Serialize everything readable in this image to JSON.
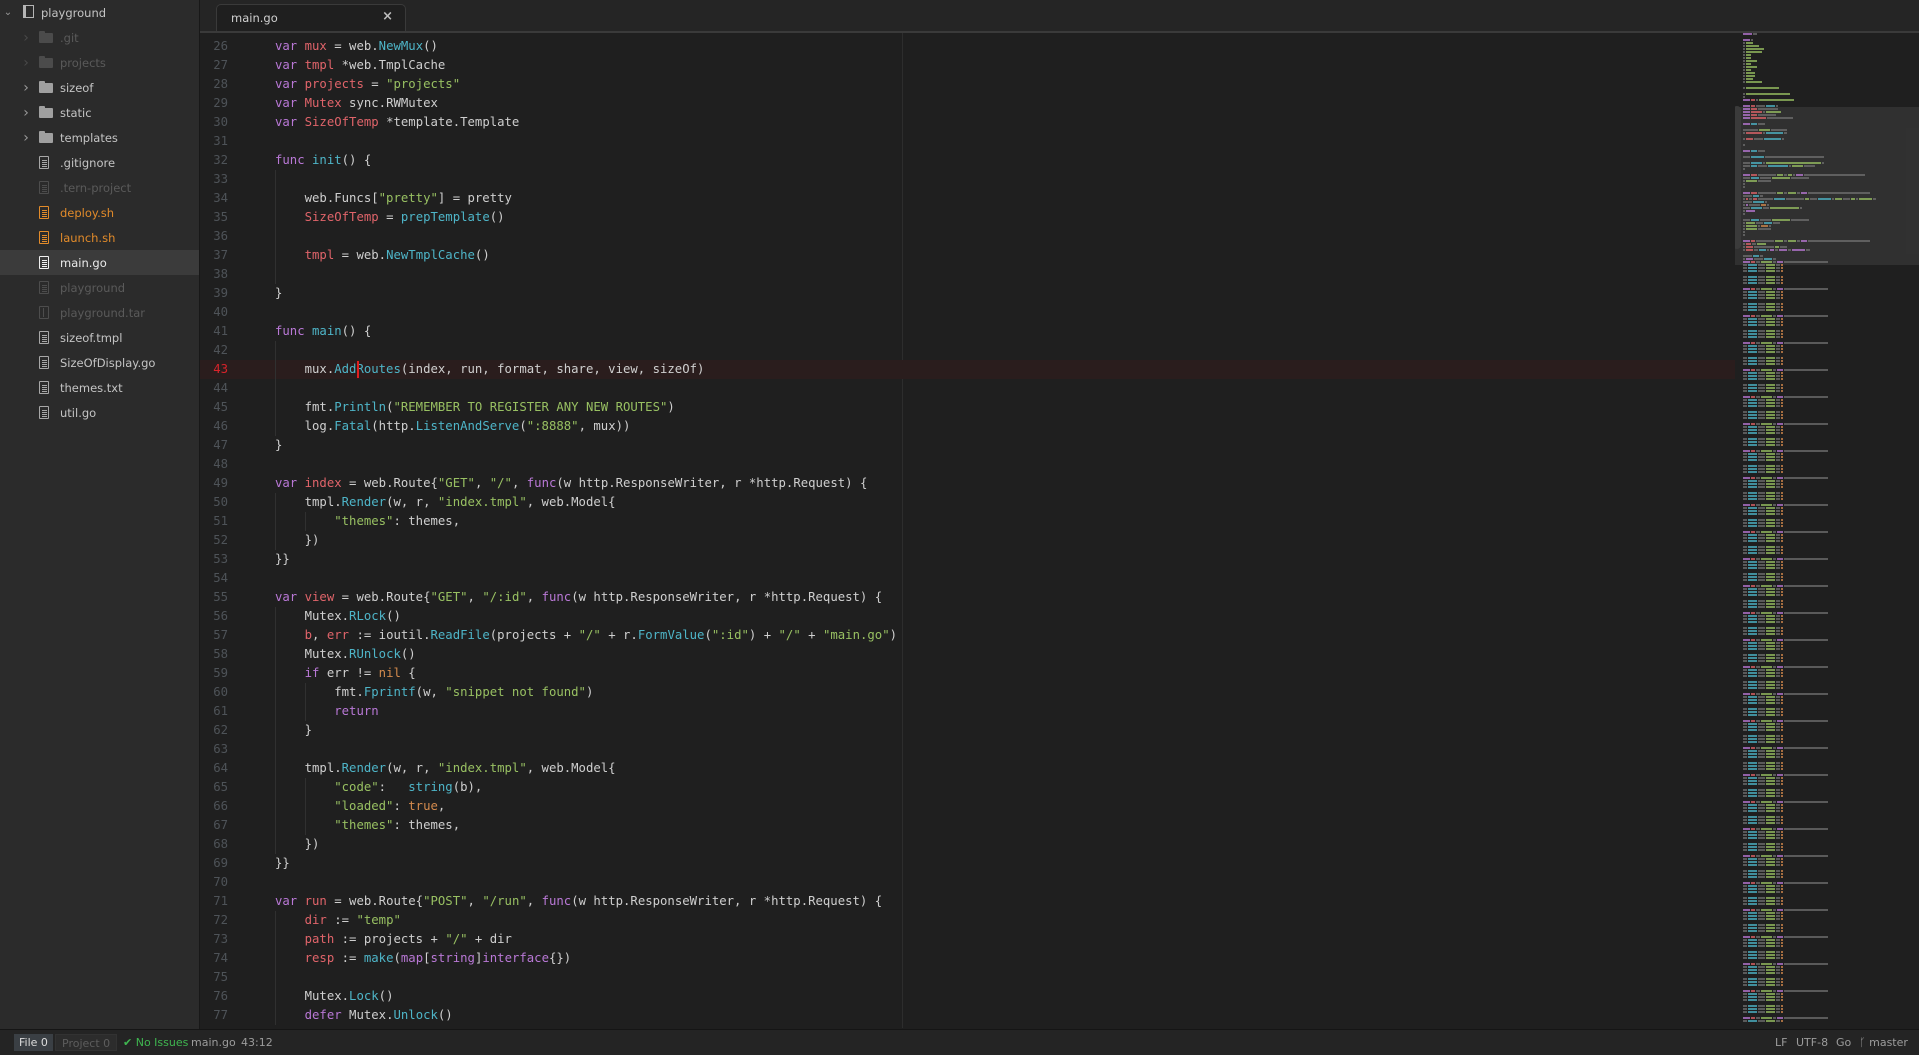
{
  "tree": {
    "root": {
      "label": "playground",
      "icon": "repo-icon"
    },
    "items": [
      {
        "label": ".git",
        "type": "folder",
        "state": "ignored"
      },
      {
        "label": "projects",
        "type": "folder",
        "state": "ignored"
      },
      {
        "label": "sizeof",
        "type": "folder",
        "state": "normal"
      },
      {
        "label": "static",
        "type": "folder",
        "state": "normal"
      },
      {
        "label": "templates",
        "type": "folder",
        "state": "normal"
      },
      {
        "label": ".gitignore",
        "type": "file",
        "state": "normal"
      },
      {
        "label": ".tern-project",
        "type": "file",
        "state": "ignored"
      },
      {
        "label": "deploy.sh",
        "type": "file",
        "state": "modified"
      },
      {
        "label": "launch.sh",
        "type": "file",
        "state": "modified"
      },
      {
        "label": "main.go",
        "type": "file",
        "state": "selected"
      },
      {
        "label": "playground",
        "type": "file",
        "state": "ignored"
      },
      {
        "label": "playground.tar",
        "type": "zip",
        "state": "ignored"
      },
      {
        "label": "sizeof.tmpl",
        "type": "file",
        "state": "normal"
      },
      {
        "label": "SizeOfDisplay.go",
        "type": "file",
        "state": "normal"
      },
      {
        "label": "themes.txt",
        "type": "file",
        "state": "normal"
      },
      {
        "label": "util.go",
        "type": "file",
        "state": "normal"
      }
    ]
  },
  "tabs": [
    {
      "label": "main.go",
      "close_icon": "×",
      "active": true
    }
  ],
  "editor": {
    "cursor_line": 43,
    "cursor_col": 12,
    "lines": [
      {
        "n": 26,
        "indent": 0,
        "tokens": [
          [
            "k",
            "var "
          ],
          [
            "v",
            "mux"
          ],
          [
            "t",
            " = web."
          ],
          [
            "f",
            "NewMux"
          ],
          [
            "t",
            "()"
          ]
        ]
      },
      {
        "n": 27,
        "indent": 0,
        "tokens": [
          [
            "k",
            "var "
          ],
          [
            "v",
            "tmpl"
          ],
          [
            "t",
            " *web.TmplCache"
          ]
        ]
      },
      {
        "n": 28,
        "indent": 0,
        "tokens": [
          [
            "k",
            "var "
          ],
          [
            "v",
            "projects"
          ],
          [
            "t",
            " = "
          ],
          [
            "s",
            "\"projects\""
          ]
        ]
      },
      {
        "n": 29,
        "indent": 0,
        "tokens": [
          [
            "k",
            "var "
          ],
          [
            "v",
            "Mutex"
          ],
          [
            "t",
            " sync.RWMutex"
          ]
        ]
      },
      {
        "n": 30,
        "indent": 0,
        "tokens": [
          [
            "k",
            "var "
          ],
          [
            "v",
            "SizeOfTemp"
          ],
          [
            "t",
            " *template.Template"
          ]
        ]
      },
      {
        "n": 31,
        "indent": 0,
        "tokens": []
      },
      {
        "n": 32,
        "indent": 0,
        "tokens": [
          [
            "k",
            "func "
          ],
          [
            "f",
            "init"
          ],
          [
            "t",
            "() {"
          ]
        ]
      },
      {
        "n": 33,
        "indent": 1,
        "tokens": []
      },
      {
        "n": 34,
        "indent": 1,
        "tokens": [
          [
            "t",
            "    web.Funcs["
          ],
          [
            "s",
            "\"pretty\""
          ],
          [
            "t",
            "] = pretty"
          ]
        ]
      },
      {
        "n": 35,
        "indent": 1,
        "tokens": [
          [
            "t",
            "    "
          ],
          [
            "v",
            "SizeOfTemp"
          ],
          [
            "t",
            " = "
          ],
          [
            "f",
            "prepTemplate"
          ],
          [
            "t",
            "()"
          ]
        ]
      },
      {
        "n": 36,
        "indent": 1,
        "tokens": []
      },
      {
        "n": 37,
        "indent": 1,
        "tokens": [
          [
            "t",
            "    "
          ],
          [
            "v",
            "tmpl"
          ],
          [
            "t",
            " = web."
          ],
          [
            "f",
            "NewTmplCache"
          ],
          [
            "t",
            "()"
          ]
        ]
      },
      {
        "n": 38,
        "indent": 1,
        "tokens": []
      },
      {
        "n": 39,
        "indent": 0,
        "tokens": [
          [
            "t",
            "}"
          ]
        ]
      },
      {
        "n": 40,
        "indent": 0,
        "tokens": []
      },
      {
        "n": 41,
        "indent": 0,
        "tokens": [
          [
            "k",
            "func "
          ],
          [
            "f",
            "main"
          ],
          [
            "t",
            "() {"
          ]
        ]
      },
      {
        "n": 42,
        "indent": 1,
        "tokens": []
      },
      {
        "n": 43,
        "indent": 1,
        "tokens": [
          [
            "t",
            "    mux."
          ],
          [
            "f",
            "AddRoutes"
          ],
          [
            "t",
            "(index, run, format, share, view, sizeOf)"
          ]
        ]
      },
      {
        "n": 44,
        "indent": 1,
        "tokens": []
      },
      {
        "n": 45,
        "indent": 1,
        "tokens": [
          [
            "t",
            "    fmt."
          ],
          [
            "f",
            "Println"
          ],
          [
            "t",
            "("
          ],
          [
            "s",
            "\"REMEMBER TO REGISTER ANY NEW ROUTES\""
          ],
          [
            "t",
            ")"
          ]
        ]
      },
      {
        "n": 46,
        "indent": 1,
        "tokens": [
          [
            "t",
            "    log."
          ],
          [
            "f",
            "Fatal"
          ],
          [
            "t",
            "(http."
          ],
          [
            "f",
            "ListenAndServe"
          ],
          [
            "t",
            "("
          ],
          [
            "s",
            "\":8888\""
          ],
          [
            "t",
            ", mux))"
          ]
        ]
      },
      {
        "n": 47,
        "indent": 0,
        "tokens": [
          [
            "t",
            "}"
          ]
        ]
      },
      {
        "n": 48,
        "indent": 0,
        "tokens": []
      },
      {
        "n": 49,
        "indent": 0,
        "tokens": [
          [
            "k",
            "var "
          ],
          [
            "v",
            "index"
          ],
          [
            "t",
            " = web.Route{"
          ],
          [
            "s",
            "\"GET\""
          ],
          [
            "t",
            ", "
          ],
          [
            "s",
            "\"/\""
          ],
          [
            "t",
            ", "
          ],
          [
            "k",
            "func"
          ],
          [
            "t",
            "(w http.ResponseWriter, r *http.Request) {"
          ]
        ]
      },
      {
        "n": 50,
        "indent": 1,
        "tokens": [
          [
            "t",
            "    tmpl."
          ],
          [
            "f",
            "Render"
          ],
          [
            "t",
            "(w, r, "
          ],
          [
            "s",
            "\"index.tmpl\""
          ],
          [
            "t",
            ", web.Model{"
          ]
        ]
      },
      {
        "n": 51,
        "indent": 2,
        "tokens": [
          [
            "t",
            "        "
          ],
          [
            "s",
            "\"themes\""
          ],
          [
            "t",
            ": themes,"
          ]
        ]
      },
      {
        "n": 52,
        "indent": 1,
        "tokens": [
          [
            "t",
            "    })"
          ]
        ]
      },
      {
        "n": 53,
        "indent": 0,
        "tokens": [
          [
            "t",
            "}}"
          ]
        ]
      },
      {
        "n": 54,
        "indent": 0,
        "tokens": []
      },
      {
        "n": 55,
        "indent": 0,
        "tokens": [
          [
            "k",
            "var "
          ],
          [
            "v",
            "view"
          ],
          [
            "t",
            " = web.Route{"
          ],
          [
            "s",
            "\"GET\""
          ],
          [
            "t",
            ", "
          ],
          [
            "s",
            "\"/:id\""
          ],
          [
            "t",
            ", "
          ],
          [
            "k",
            "func"
          ],
          [
            "t",
            "(w http.ResponseWriter, r *http.Request) {"
          ]
        ]
      },
      {
        "n": 56,
        "indent": 1,
        "tokens": [
          [
            "t",
            "    Mutex."
          ],
          [
            "f",
            "RLock"
          ],
          [
            "t",
            "()"
          ]
        ]
      },
      {
        "n": 57,
        "indent": 1,
        "tokens": [
          [
            "t",
            "    "
          ],
          [
            "v",
            "b"
          ],
          [
            "t",
            ", "
          ],
          [
            "v",
            "err"
          ],
          [
            "t",
            " := ioutil."
          ],
          [
            "f",
            "ReadFile"
          ],
          [
            "t",
            "(projects + "
          ],
          [
            "s",
            "\"/\""
          ],
          [
            "t",
            " + r."
          ],
          [
            "f",
            "FormValue"
          ],
          [
            "t",
            "("
          ],
          [
            "s",
            "\":id\""
          ],
          [
            "t",
            ") + "
          ],
          [
            "s",
            "\"/\""
          ],
          [
            "t",
            " + "
          ],
          [
            "s",
            "\"main.go\""
          ],
          [
            "t",
            ")"
          ]
        ]
      },
      {
        "n": 58,
        "indent": 1,
        "tokens": [
          [
            "t",
            "    Mutex."
          ],
          [
            "f",
            "RUnlock"
          ],
          [
            "t",
            "()"
          ]
        ]
      },
      {
        "n": 59,
        "indent": 1,
        "tokens": [
          [
            "t",
            "    "
          ],
          [
            "k",
            "if"
          ],
          [
            "t",
            " err != "
          ],
          [
            "c",
            "nil"
          ],
          [
            "t",
            " {"
          ]
        ]
      },
      {
        "n": 60,
        "indent": 2,
        "tokens": [
          [
            "t",
            "        fmt."
          ],
          [
            "f",
            "Fprintf"
          ],
          [
            "t",
            "(w, "
          ],
          [
            "s",
            "\"snippet not found\""
          ],
          [
            "t",
            ")"
          ]
        ]
      },
      {
        "n": 61,
        "indent": 2,
        "tokens": [
          [
            "t",
            "        "
          ],
          [
            "k",
            "return"
          ]
        ]
      },
      {
        "n": 62,
        "indent": 1,
        "tokens": [
          [
            "t",
            "    }"
          ]
        ]
      },
      {
        "n": 63,
        "indent": 1,
        "tokens": []
      },
      {
        "n": 64,
        "indent": 1,
        "tokens": [
          [
            "t",
            "    tmpl."
          ],
          [
            "f",
            "Render"
          ],
          [
            "t",
            "(w, r, "
          ],
          [
            "s",
            "\"index.tmpl\""
          ],
          [
            "t",
            ", web.Model{"
          ]
        ]
      },
      {
        "n": 65,
        "indent": 2,
        "tokens": [
          [
            "t",
            "        "
          ],
          [
            "s",
            "\"code\""
          ],
          [
            "t",
            ":   "
          ],
          [
            "f",
            "string"
          ],
          [
            "t",
            "(b),"
          ]
        ]
      },
      {
        "n": 66,
        "indent": 2,
        "tokens": [
          [
            "t",
            "        "
          ],
          [
            "s",
            "\"loaded\""
          ],
          [
            "t",
            ": "
          ],
          [
            "c",
            "true"
          ],
          [
            "t",
            ","
          ]
        ]
      },
      {
        "n": 67,
        "indent": 2,
        "tokens": [
          [
            "t",
            "        "
          ],
          [
            "s",
            "\"themes\""
          ],
          [
            "t",
            ": themes,"
          ]
        ]
      },
      {
        "n": 68,
        "indent": 1,
        "tokens": [
          [
            "t",
            "    })"
          ]
        ]
      },
      {
        "n": 69,
        "indent": 0,
        "tokens": [
          [
            "t",
            "}}"
          ]
        ]
      },
      {
        "n": 70,
        "indent": 0,
        "tokens": []
      },
      {
        "n": 71,
        "indent": 0,
        "tokens": [
          [
            "k",
            "var "
          ],
          [
            "v",
            "run"
          ],
          [
            "t",
            " = web.Route{"
          ],
          [
            "s",
            "\"POST\""
          ],
          [
            "t",
            ", "
          ],
          [
            "s",
            "\"/run\""
          ],
          [
            "t",
            ", "
          ],
          [
            "k",
            "func"
          ],
          [
            "t",
            "(w http.ResponseWriter, r *http.Request) {"
          ]
        ]
      },
      {
        "n": 72,
        "indent": 1,
        "tokens": [
          [
            "t",
            "    "
          ],
          [
            "v",
            "dir"
          ],
          [
            "t",
            " := "
          ],
          [
            "s",
            "\"temp\""
          ]
        ]
      },
      {
        "n": 73,
        "indent": 1,
        "tokens": [
          [
            "t",
            "    "
          ],
          [
            "v",
            "path"
          ],
          [
            "t",
            " := projects + "
          ],
          [
            "s",
            "\"/\""
          ],
          [
            "t",
            " + dir"
          ]
        ]
      },
      {
        "n": 74,
        "indent": 1,
        "tokens": [
          [
            "t",
            "    "
          ],
          [
            "v",
            "resp"
          ],
          [
            "t",
            " := "
          ],
          [
            "f",
            "make"
          ],
          [
            "t",
            "("
          ],
          [
            "k",
            "map"
          ],
          [
            "t",
            "["
          ],
          [
            "k",
            "string"
          ],
          [
            "t",
            "]"
          ],
          [
            "k",
            "interface"
          ],
          [
            "t",
            "{})"
          ]
        ]
      },
      {
        "n": 75,
        "indent": 1,
        "tokens": []
      },
      {
        "n": 76,
        "indent": 1,
        "tokens": [
          [
            "t",
            "    Mutex."
          ],
          [
            "f",
            "Lock"
          ],
          [
            "t",
            "()"
          ]
        ]
      },
      {
        "n": 77,
        "indent": 1,
        "tokens": [
          [
            "t",
            "    "
          ],
          [
            "k",
            "defer"
          ],
          [
            "t",
            " Mutex."
          ],
          [
            "f",
            "Unlock"
          ],
          [
            "t",
            "()"
          ]
        ]
      }
    ]
  },
  "statusbar": {
    "file_label": "File",
    "file_count": "0",
    "project_label": "Project",
    "project_count": "0",
    "issues": "No Issues",
    "issues_icon": "✔",
    "filename": "main.go",
    "position": "43:12",
    "line_ending": "LF",
    "encoding": "UTF-8",
    "grammar": "Go",
    "branch_icon": "ᚴ",
    "branch": "master"
  },
  "colors": {
    "keyword": "#b978d6",
    "variable": "#e0646a",
    "function": "#4eb5c8",
    "string": "#98c062",
    "constant": "#d38a4d",
    "modified": "#e28b2a",
    "cursor": "#e02020",
    "ok": "#3fb650"
  }
}
